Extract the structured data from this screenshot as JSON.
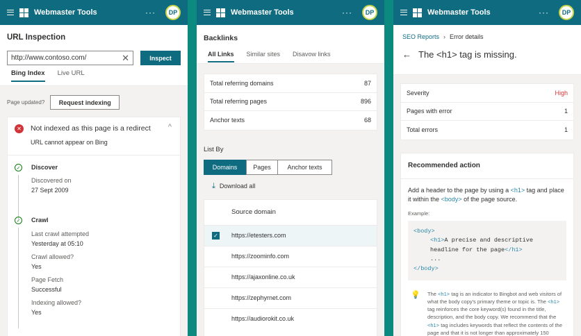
{
  "app": {
    "title": "Webmaster Tools",
    "avatar": "DP",
    "more": "···"
  },
  "p1": {
    "page_title": "URL Inspection",
    "url_value": "http://www.contoso.com/",
    "inspect": "Inspect",
    "tabs": [
      "Bing Index",
      "Live URL"
    ],
    "page_updated": "Page updated?",
    "request_indexing": "Request indexing",
    "status_title": "Not indexed as this page is a redirect",
    "status_sub": "URL cannot appear on Bing",
    "discover": {
      "title": "Discover",
      "label": "Discovered on",
      "value": "27 Sept 2009"
    },
    "crawl": {
      "title": "Crawl",
      "items": [
        {
          "label": "Last crawl attempted",
          "value": "Yesterday at 05:10"
        },
        {
          "label": "Crawl allowed?",
          "value": "Yes"
        },
        {
          "label": "Page Fetch",
          "value": "Successful"
        },
        {
          "label": "Indexing allowed?",
          "value": "Yes"
        }
      ]
    }
  },
  "p2": {
    "page_title": "Backlinks",
    "tabs": [
      "All Links",
      "Similar sites",
      "Disavow links"
    ],
    "stats": [
      {
        "label": "Total referring domains",
        "value": "87"
      },
      {
        "label": "Total referring pages",
        "value": "896"
      },
      {
        "label": "Anchor texts",
        "value": "68"
      }
    ],
    "list_by": "List By",
    "segments": [
      "Domains",
      "Pages",
      "Anchor texts"
    ],
    "download": "Download all",
    "column": "Source domain",
    "domains": [
      "https://etesters.com",
      "https://zoominfo.com",
      "https://ajaxonline.co.uk",
      "https://zephyrnet.com",
      "https://audiorokit.co.uk"
    ]
  },
  "p3": {
    "breadcrumb": [
      "SEO Reports",
      "Error details"
    ],
    "title": "The <h1> tag is missing.",
    "stats": [
      {
        "label": "Severity",
        "value": "High"
      },
      {
        "label": "Pages with error",
        "value": "1"
      },
      {
        "label": "Total errors",
        "value": "1"
      }
    ],
    "rec_title": "Recommended action",
    "rec_text": [
      "Add a header to the page by using a ",
      "<h1>",
      " tag and place it within the ",
      "<body>",
      " of the page source."
    ],
    "example": "Example:",
    "code": [
      "<body>",
      "<h1>",
      "A precise and descriptive headline for the page",
      "</h1>",
      "...",
      "</body>"
    ],
    "info": [
      "The ",
      "<h1>",
      " tag is an indicator to Bingbot and web visitors of what the body copy's primary theme or topic is. The ",
      "<h1>",
      " tag reinforces the core keyword(s) found in the title, description, and the body copy. We recommend that the ",
      "<h1>",
      " tag includes keywords that reflect the contents of the page and that it is not longer than approximately 150"
    ]
  },
  "colors": {
    "accent": "#0f6b80",
    "error": "#d13438",
    "high": "#d13438",
    "success": "#107c10"
  }
}
